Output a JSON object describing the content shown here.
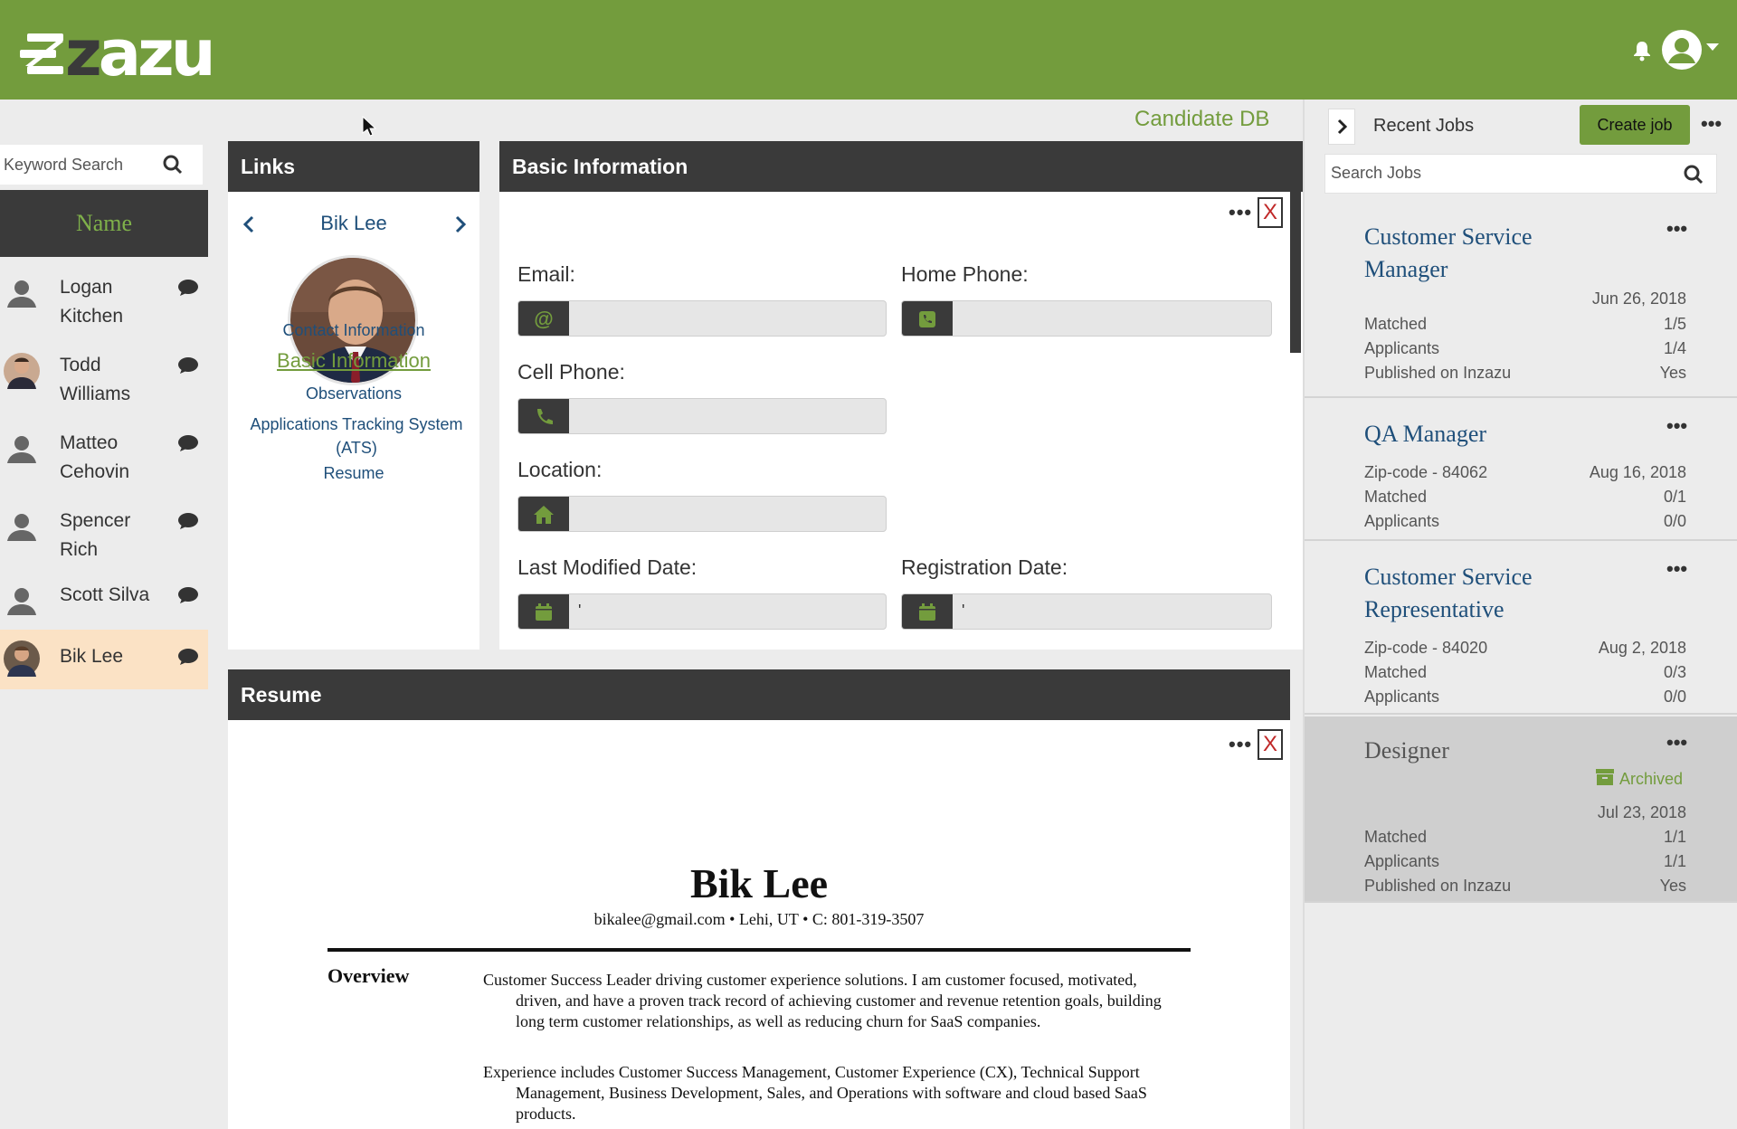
{
  "colors": {
    "brand_green": "#739c3d",
    "dark": "#3a3a3a",
    "link_blue": "#1f4f7a",
    "active_row": "#fbe2c5"
  },
  "header": {
    "logo_text_a": "zazu",
    "logo_mark": "in"
  },
  "page_label": "Candidate DB",
  "search": {
    "keyword_placeholder": "Keyword Search"
  },
  "names": {
    "header": "Name",
    "items": [
      {
        "name_line1": "Logan",
        "name_line2": "Kitchen",
        "avatar": "generic-user"
      },
      {
        "name_line1": "Todd",
        "name_line2": "Williams",
        "avatar": "photo"
      },
      {
        "name_line1": "Matteo",
        "name_line2": "Cehovin",
        "avatar": "generic-user"
      },
      {
        "name_line1": "Spencer",
        "name_line2": "Rich",
        "avatar": "generic-user"
      },
      {
        "name_line1": "Scott Silva",
        "name_line2": "",
        "avatar": "generic-user"
      },
      {
        "name_line1": "Bik Lee",
        "name_line2": "",
        "avatar": "photo",
        "active": true
      }
    ]
  },
  "links": {
    "title": "Links",
    "candidate": "Bik Lee",
    "items": [
      "Contact Information",
      "Basic Information",
      "Observations",
      "Applications Tracking System (ATS)",
      "Resume"
    ]
  },
  "basic_info": {
    "title": "Basic Information",
    "close": "X",
    "email_label": "Email:",
    "home_phone_label": "Home Phone:",
    "cell_phone_label": "Cell Phone:",
    "location_label": "Location:",
    "last_modified_label": "Last Modified Date:",
    "registration_label": "Registration Date:",
    "email_value": "",
    "home_phone_value": "",
    "cell_phone_value": "",
    "location_value": "",
    "last_modified_value": "'",
    "registration_value": "'"
  },
  "resume": {
    "title": "Resume",
    "close": "X",
    "name": "Bik Lee",
    "contact": "bikalee@gmail.com • Lehi, UT • C: 801-319-3507",
    "section": "Overview",
    "para1": "Customer Success Leader driving customer experience solutions. I am customer focused, motivated, driven, and have a proven track record of achieving customer and revenue retention goals, building long term customer relationships, as well as reducing churn for SaaS companies.",
    "para2": "Experience includes Customer Success Management, Customer Experience (CX), Technical Support Management, Business Development, Sales, and Operations with software and cloud based SaaS products."
  },
  "recent_jobs": {
    "title": "Recent Jobs",
    "create_label": "Create job",
    "search_placeholder": "Search Jobs",
    "jobs": [
      {
        "title": "Customer Service Manager",
        "date": "Jun 26, 2018",
        "zip": "",
        "matched": "1/5",
        "applicants": "1/4",
        "published": "Yes"
      },
      {
        "title": "QA Manager",
        "date": "Aug 16, 2018",
        "zip": "Zip-code - 84062",
        "matched": "0/1",
        "applicants": "0/0"
      },
      {
        "title": "Customer Service Representative",
        "date": "Aug 2, 2018",
        "zip": "Zip-code - 84020",
        "matched": "0/3",
        "applicants": "0/0"
      },
      {
        "title": "Designer",
        "status": "Archived",
        "date": "Jul 23, 2018",
        "matched": "1/1",
        "applicants": "1/1",
        "published": "Yes"
      }
    ],
    "labels": {
      "matched": "Matched",
      "applicants": "Applicants",
      "published": "Published on Inzazu"
    }
  }
}
